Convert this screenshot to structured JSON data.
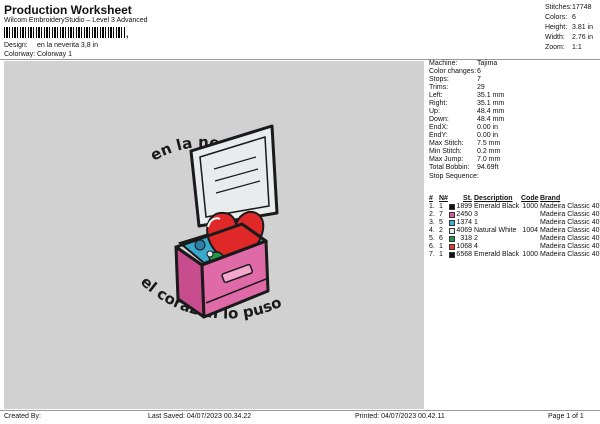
{
  "header": {
    "title": "Production Worksheet",
    "subtitle": "Wilcom EmbroideryStudio – Level 3 Advanced",
    "barcode_tail": ",",
    "design_label": "Design:",
    "design_value": "en la neverita 3,8 in",
    "colorway_label": "Colorway:",
    "colorway_value": "Colorway 1"
  },
  "stats": [
    {
      "key": "Stitches:",
      "value": "17748"
    },
    {
      "key": "Colors:",
      "value": "6"
    },
    {
      "key": "Height:",
      "value": "3.81 in"
    },
    {
      "key": "Width:",
      "value": "2.76 in"
    },
    {
      "key": "Zoom:",
      "value": "1:1"
    }
  ],
  "info": [
    {
      "key": "Machine:",
      "value": "Tajima"
    },
    {
      "key": "Color changes:",
      "value": "6"
    },
    {
      "key": "Stops:",
      "value": "7"
    },
    {
      "key": "Trims:",
      "value": "29"
    },
    {
      "key": "Left:",
      "value": "35.1 mm"
    },
    {
      "key": "Right:",
      "value": "35.1 mm"
    },
    {
      "key": "Up:",
      "value": "48.4 mm"
    },
    {
      "key": "Down:",
      "value": "48.4 mm"
    },
    {
      "key": "EndX:",
      "value": "0.00 in"
    },
    {
      "key": "EndY:",
      "value": "0.00 in"
    },
    {
      "key": "Max Stitch:",
      "value": "7.5 mm"
    },
    {
      "key": "Min Stitch:",
      "value": "0.2 mm"
    },
    {
      "key": "Max Jump:",
      "value": "7.0 mm"
    },
    {
      "key": "Total Bobbin:",
      "value": "94.69ft"
    }
  ],
  "sequence": {
    "title": "Stop Sequence:",
    "headers": {
      "stop": "#",
      "n": "N#",
      "st": "St.",
      "desc": "Description",
      "code": "Code",
      "brand": "Brand"
    },
    "rows": [
      {
        "stop": "1.",
        "n": "1",
        "color": "#111111",
        "st": "1899",
        "desc": "Emerald Black",
        "code": "1000",
        "brand": "Madeira Classic 40"
      },
      {
        "stop": "2.",
        "n": "7",
        "color": "#e0559a",
        "st": "2450",
        "desc": "3",
        "code": "",
        "brand": "Madeira Classic 40"
      },
      {
        "stop": "3.",
        "n": "5",
        "color": "#3bb0d8",
        "st": "1374",
        "desc": "1",
        "code": "",
        "brand": "Madeira Classic 40"
      },
      {
        "stop": "4.",
        "n": "2",
        "color": "#e6eef4",
        "st": "4069",
        "desc": "Natural White",
        "code": "1004",
        "brand": "Madeira Classic 40"
      },
      {
        "stop": "5.",
        "n": "6",
        "color": "#1f9a4a",
        "st": "318",
        "desc": "2",
        "code": "",
        "brand": "Madeira Classic 40"
      },
      {
        "stop": "6.",
        "n": "1",
        "color": "#e23c2c",
        "st": "1068",
        "desc": "4",
        "code": "",
        "brand": "Madeira Classic 40"
      },
      {
        "stop": "7.",
        "n": "1",
        "color": "#111111",
        "st": "6568",
        "desc": "Emerald Black",
        "code": "1000",
        "brand": "Madeira Classic 40"
      }
    ]
  },
  "design": {
    "top_text": "en la neverita",
    "bottom_text": "el corazon lo puso",
    "colors": {
      "background": "#d1d1d1",
      "cooler": "#e06aa8",
      "lid": "#e8ecec",
      "ice": "#3aa9cc",
      "heart": "#e02828",
      "outline": "#1a1a1a"
    }
  },
  "footer": {
    "created_by": "Created By:",
    "last_saved": "Last Saved: 04/07/2023 00.34.22",
    "printed": "Printed: 04/07/2023 00.42.11",
    "page": "Page 1 of 1"
  }
}
